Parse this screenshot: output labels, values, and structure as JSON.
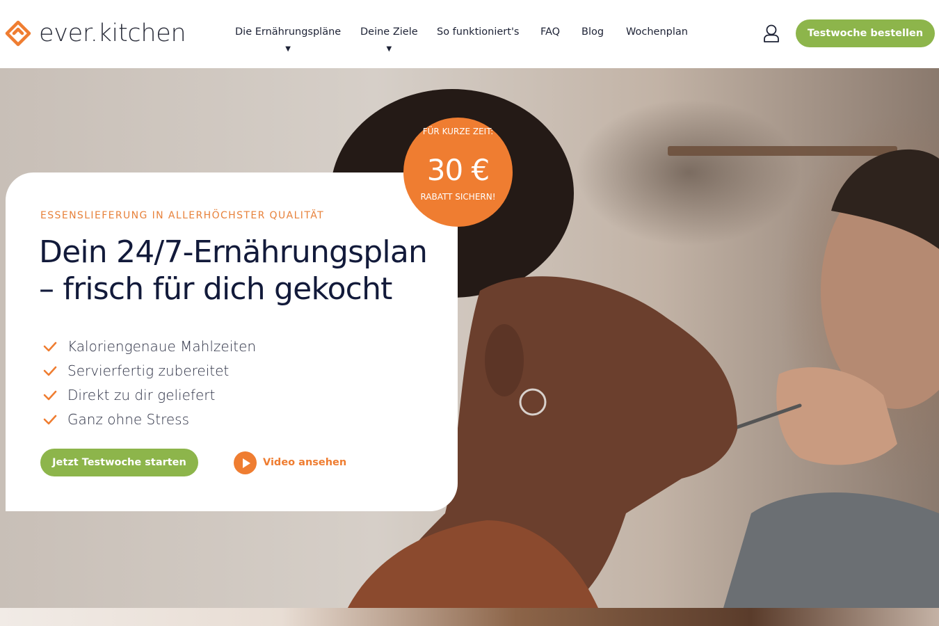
{
  "brand": {
    "name": "ever.kitchen",
    "accent": "#ef7d31",
    "green": "#8db54b",
    "dark": "#121a3a"
  },
  "nav": {
    "items": [
      {
        "label": "Die Ernährungspläne",
        "has_dropdown": true
      },
      {
        "label": "Deine Ziele",
        "has_dropdown": true
      },
      {
        "label": "So funktioniert's",
        "has_dropdown": false
      },
      {
        "label": "FAQ",
        "has_dropdown": false
      },
      {
        "label": "Blog",
        "has_dropdown": false
      },
      {
        "label": "Wochenplan",
        "has_dropdown": false
      }
    ],
    "caret": "▼",
    "account_icon": "user-icon",
    "cta_label": "Testwoche bestellen"
  },
  "badge": {
    "top": "FÜR KURZE ZEIT:",
    "amount": "30 €",
    "bottom": "RABATT SICHERN!"
  },
  "hero": {
    "eyebrow": "ESSENSLIEFERUNG IN ALLERHÖCHSTER QUALITÄT",
    "headline": "Dein 24/7-Ernährungsplan – frisch für dich gekocht",
    "benefits": [
      "Kaloriengenaue Mahlzeiten",
      "Servierfertig zubereitet",
      "Direkt zu dir geliefert",
      "Ganz ohne Stress"
    ],
    "cta_label": "Jetzt Testwoche starten",
    "video_label": "Video ansehen",
    "video_icon": "play-icon",
    "check_icon": "check-icon"
  }
}
